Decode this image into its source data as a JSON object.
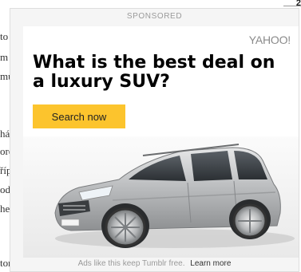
{
  "background": {
    "lines": [
      "to",
      "m",
      "mu",
      "hár",
      "oro",
      "říp",
      "od",
      "hel",
      "tor"
    ],
    "corner_text": "2"
  },
  "ad": {
    "sponsored_label": "SPONSORED",
    "brand_logo": "YAHOO!",
    "headline": "What is the best deal on a luxury SUV?",
    "cta_label": "Search now",
    "image_alt": "silver-suv-image",
    "footer_text": "Ads like this keep Tumblr free.",
    "learn_more_label": "Learn more",
    "colors": {
      "cta": "#fcc42d",
      "card_bg": "#f5f5f5",
      "car_body": "#c0c2c4"
    }
  }
}
